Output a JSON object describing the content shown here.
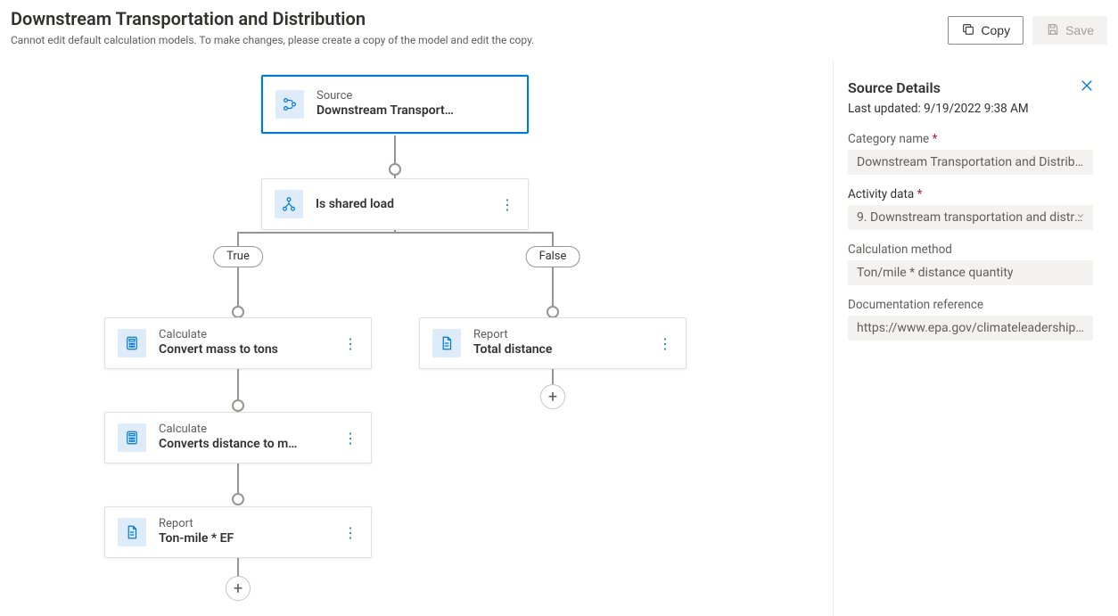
{
  "header": {
    "title": "Downstream Transportation and Distribution",
    "description": "Cannot edit default calculation models. To make changes, please create a copy of the model and edit the copy.",
    "copy_label": "Copy",
    "save_label": "Save"
  },
  "nodes": {
    "source": {
      "type": "Source",
      "title": "Downstream Transport…"
    },
    "shared": {
      "type": "",
      "title": "Is shared load"
    },
    "calc1": {
      "type": "Calculate",
      "title": "Convert mass to tons"
    },
    "calc2": {
      "type": "Calculate",
      "title": "Converts distance to m…"
    },
    "report1": {
      "type": "Report",
      "title": "Ton-mile * EF"
    },
    "report2": {
      "type": "Report",
      "title": "Total distance"
    }
  },
  "branches": {
    "true_label": "True",
    "false_label": "False"
  },
  "panel": {
    "title": "Source Details",
    "updated_text": "Last updated: 9/19/2022 9:38 AM",
    "category_label": "Category name",
    "category_value": "Downstream Transportation and Distribution",
    "activity_label": "Activity data",
    "activity_value": "9. Downstream transportation and distri…",
    "method_label": "Calculation method",
    "method_value": "Ton/mile * distance quantity",
    "doc_label": "Documentation reference",
    "doc_value": "https://www.epa.gov/climateleadership/sco…"
  }
}
